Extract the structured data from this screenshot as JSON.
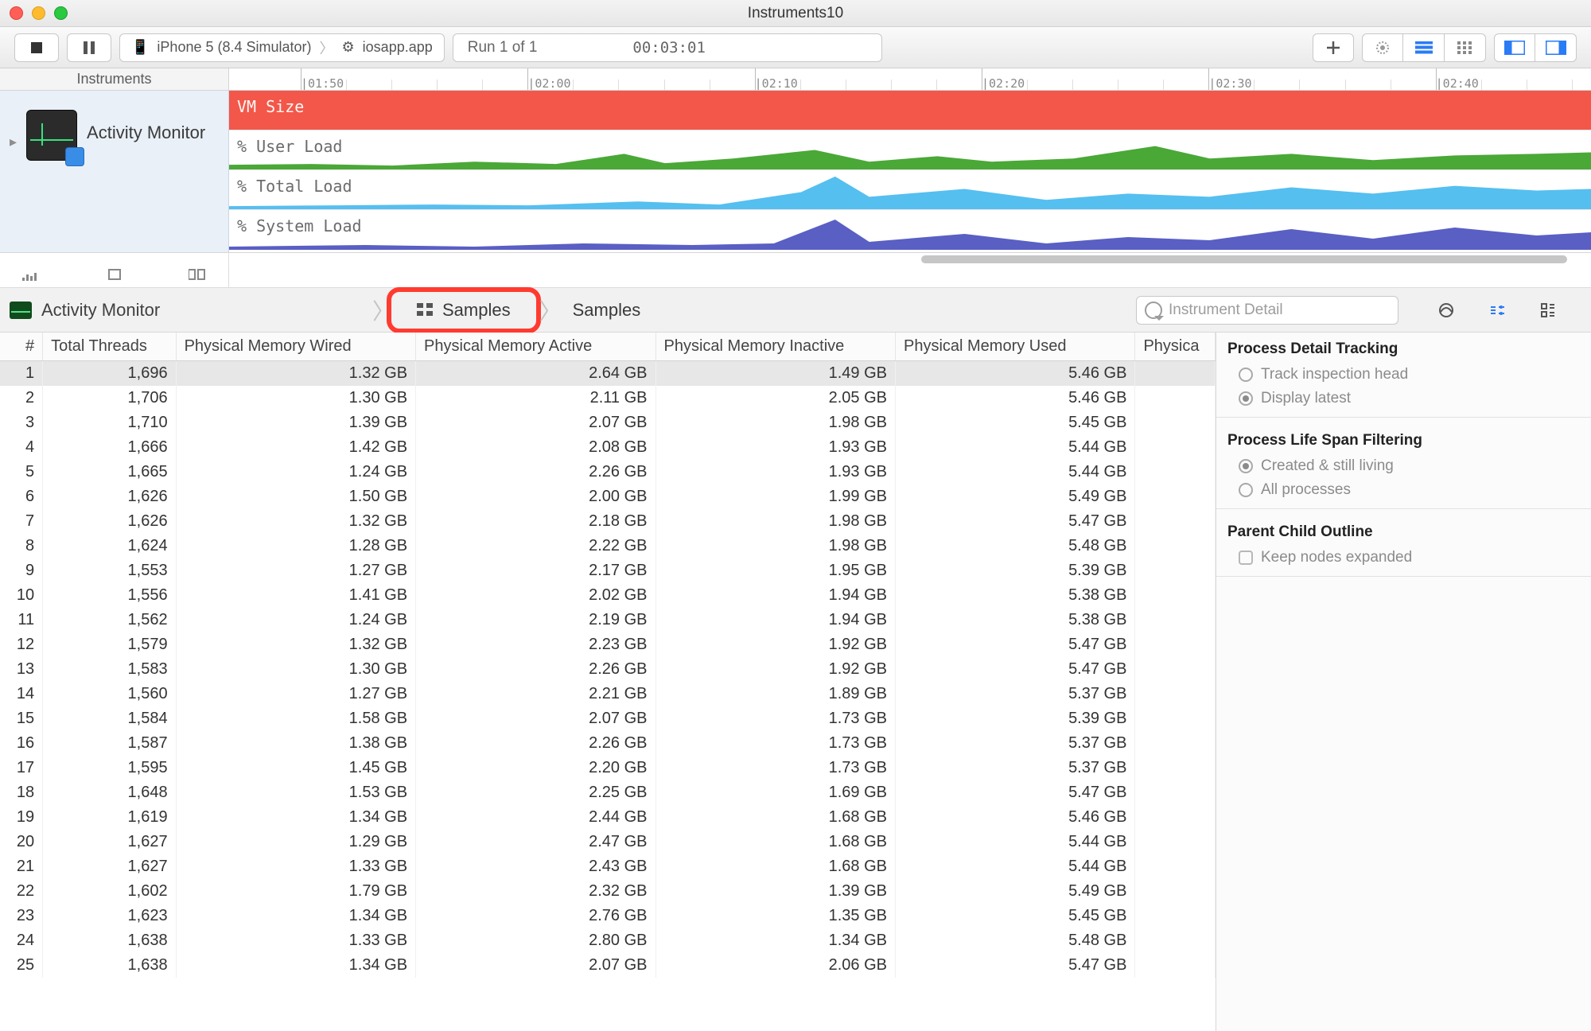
{
  "window": {
    "title": "Instruments10"
  },
  "toolbar": {
    "device": "iPhone 5 (8.4 Simulator)",
    "target": "iosapp.app",
    "run_label": "Run 1 of 1",
    "elapsed": "00:03:01"
  },
  "ruler": {
    "left_label": "Instruments",
    "ticks": [
      "01:50",
      "02:00",
      "02:10",
      "02:20",
      "02:30",
      "02:40"
    ]
  },
  "instrument": {
    "name": "Activity Monitor",
    "tracks": [
      "VM Size",
      "% User Load",
      "% Total Load",
      "% System Load"
    ]
  },
  "detail": {
    "title": "Activity Monitor",
    "crumb1": "Samples",
    "crumb2": "Samples",
    "search_placeholder": "Instrument Detail"
  },
  "table": {
    "columns": [
      "#",
      "Total Threads",
      "Physical Memory Wired",
      "Physical Memory Active",
      "Physical Memory Inactive",
      "Physical Memory Used",
      "Physica"
    ],
    "rows": [
      {
        "i": 1,
        "threads": "1,696",
        "wired": "1.32 GB",
        "active": "2.64 GB",
        "inactive": "1.49 GB",
        "used": "5.46 GB"
      },
      {
        "i": 2,
        "threads": "1,706",
        "wired": "1.30 GB",
        "active": "2.11 GB",
        "inactive": "2.05 GB",
        "used": "5.46 GB"
      },
      {
        "i": 3,
        "threads": "1,710",
        "wired": "1.39 GB",
        "active": "2.07 GB",
        "inactive": "1.98 GB",
        "used": "5.45 GB"
      },
      {
        "i": 4,
        "threads": "1,666",
        "wired": "1.42 GB",
        "active": "2.08 GB",
        "inactive": "1.93 GB",
        "used": "5.44 GB"
      },
      {
        "i": 5,
        "threads": "1,665",
        "wired": "1.24 GB",
        "active": "2.26 GB",
        "inactive": "1.93 GB",
        "used": "5.44 GB"
      },
      {
        "i": 6,
        "threads": "1,626",
        "wired": "1.50 GB",
        "active": "2.00 GB",
        "inactive": "1.99 GB",
        "used": "5.49 GB"
      },
      {
        "i": 7,
        "threads": "1,626",
        "wired": "1.32 GB",
        "active": "2.18 GB",
        "inactive": "1.98 GB",
        "used": "5.47 GB"
      },
      {
        "i": 8,
        "threads": "1,624",
        "wired": "1.28 GB",
        "active": "2.22 GB",
        "inactive": "1.98 GB",
        "used": "5.48 GB"
      },
      {
        "i": 9,
        "threads": "1,553",
        "wired": "1.27 GB",
        "active": "2.17 GB",
        "inactive": "1.95 GB",
        "used": "5.39 GB"
      },
      {
        "i": 10,
        "threads": "1,556",
        "wired": "1.41 GB",
        "active": "2.02 GB",
        "inactive": "1.94 GB",
        "used": "5.38 GB"
      },
      {
        "i": 11,
        "threads": "1,562",
        "wired": "1.24 GB",
        "active": "2.19 GB",
        "inactive": "1.94 GB",
        "used": "5.38 GB"
      },
      {
        "i": 12,
        "threads": "1,579",
        "wired": "1.32 GB",
        "active": "2.23 GB",
        "inactive": "1.92 GB",
        "used": "5.47 GB"
      },
      {
        "i": 13,
        "threads": "1,583",
        "wired": "1.30 GB",
        "active": "2.26 GB",
        "inactive": "1.92 GB",
        "used": "5.47 GB"
      },
      {
        "i": 14,
        "threads": "1,560",
        "wired": "1.27 GB",
        "active": "2.21 GB",
        "inactive": "1.89 GB",
        "used": "5.37 GB"
      },
      {
        "i": 15,
        "threads": "1,584",
        "wired": "1.58 GB",
        "active": "2.07 GB",
        "inactive": "1.73 GB",
        "used": "5.39 GB"
      },
      {
        "i": 16,
        "threads": "1,587",
        "wired": "1.38 GB",
        "active": "2.26 GB",
        "inactive": "1.73 GB",
        "used": "5.37 GB"
      },
      {
        "i": 17,
        "threads": "1,595",
        "wired": "1.45 GB",
        "active": "2.20 GB",
        "inactive": "1.73 GB",
        "used": "5.37 GB"
      },
      {
        "i": 18,
        "threads": "1,648",
        "wired": "1.53 GB",
        "active": "2.25 GB",
        "inactive": "1.69 GB",
        "used": "5.47 GB"
      },
      {
        "i": 19,
        "threads": "1,619",
        "wired": "1.34 GB",
        "active": "2.44 GB",
        "inactive": "1.68 GB",
        "used": "5.46 GB"
      },
      {
        "i": 20,
        "threads": "1,627",
        "wired": "1.29 GB",
        "active": "2.47 GB",
        "inactive": "1.68 GB",
        "used": "5.44 GB"
      },
      {
        "i": 21,
        "threads": "1,627",
        "wired": "1.33 GB",
        "active": "2.43 GB",
        "inactive": "1.68 GB",
        "used": "5.44 GB"
      },
      {
        "i": 22,
        "threads": "1,602",
        "wired": "1.79 GB",
        "active": "2.32 GB",
        "inactive": "1.39 GB",
        "used": "5.49 GB"
      },
      {
        "i": 23,
        "threads": "1,623",
        "wired": "1.34 GB",
        "active": "2.76 GB",
        "inactive": "1.35 GB",
        "used": "5.45 GB"
      },
      {
        "i": 24,
        "threads": "1,638",
        "wired": "1.33 GB",
        "active": "2.80 GB",
        "inactive": "1.34 GB",
        "used": "5.48 GB"
      },
      {
        "i": 25,
        "threads": "1,638",
        "wired": "1.34 GB",
        "active": "2.07 GB",
        "inactive": "2.06 GB",
        "used": "5.47 GB"
      }
    ]
  },
  "side": {
    "h1": "Process Detail Tracking",
    "o1": "Track inspection head",
    "o2": "Display latest",
    "h2": "Process Life Span Filtering",
    "o3": "Created & still living",
    "o4": "All processes",
    "h3": "Parent Child Outline",
    "o5": "Keep nodes expanded"
  }
}
